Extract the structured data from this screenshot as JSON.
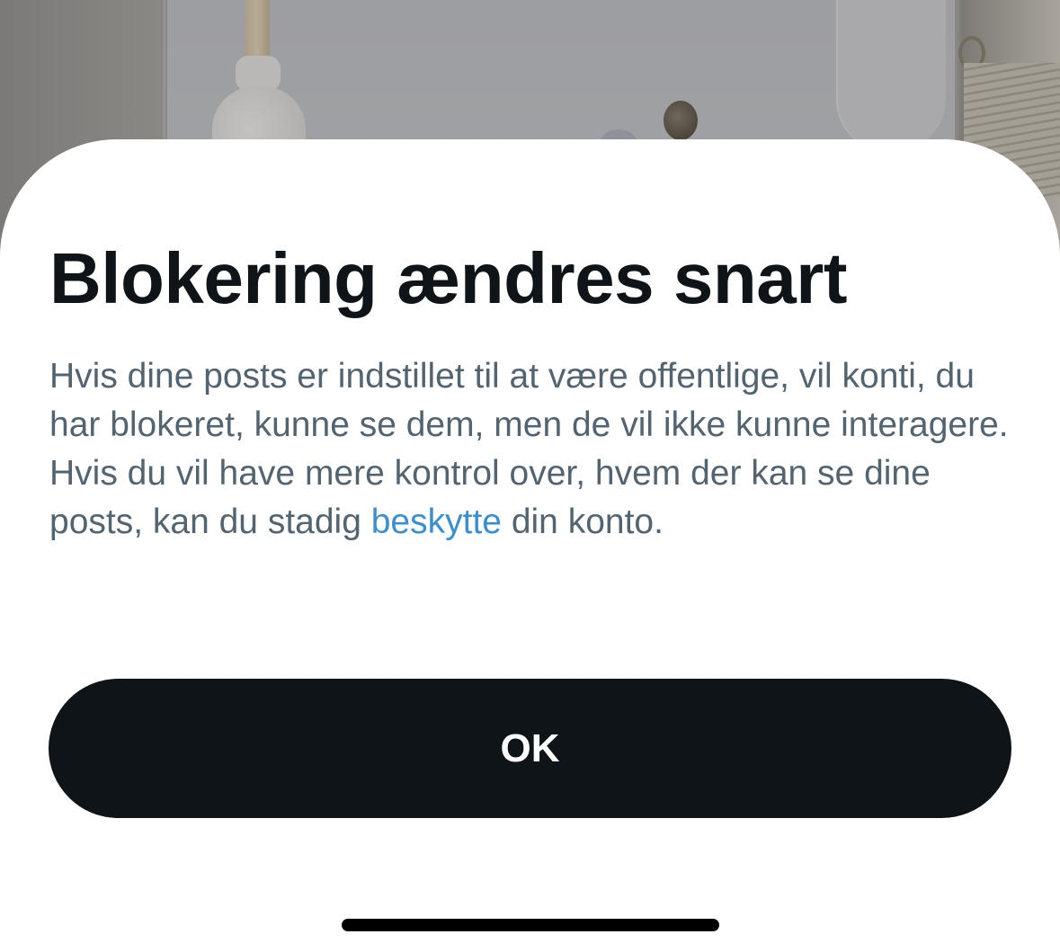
{
  "sheet": {
    "title": "Blokering ændres snart",
    "body_before_link": "Hvis dine posts er indstillet til at være offentlige, vil konti, du har blokeret, kunne se dem, men de vil ikke kunne interagere. Hvis du vil have mere kontrol over, hvem der kan se dine posts, kan du stadig ",
    "link_text": "beskytte",
    "body_after_link": " din konto.",
    "ok_label": "OK"
  },
  "colors": {
    "title": "#0f1419",
    "body": "#536471",
    "link": "#3b8fd0",
    "button_bg": "#0f1419",
    "button_text": "#ffffff",
    "sheet_bg": "#ffffff"
  }
}
